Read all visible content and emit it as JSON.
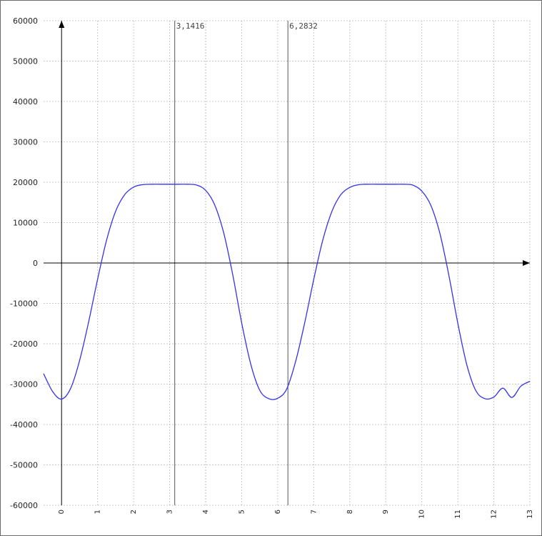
{
  "chart_data": {
    "type": "line",
    "title": "",
    "xlabel": "",
    "ylabel": "",
    "xlim": [
      -0.5,
      13
    ],
    "ylim": [
      -60000,
      60000
    ],
    "x_ticks": [
      0,
      1,
      2,
      3,
      4,
      5,
      6,
      7,
      8,
      9,
      10,
      11,
      12,
      13
    ],
    "y_ticks": [
      60000,
      50000,
      40000,
      30000,
      20000,
      10000,
      0,
      -10000,
      -20000,
      -30000,
      -40000,
      -50000,
      -60000
    ],
    "grid": true,
    "legend": "none",
    "colors": {
      "series": "#3333ee",
      "axes": "#000000",
      "grid": "#c8c8c8",
      "markers": "#555555"
    },
    "markers": [
      {
        "x": 3.1416,
        "label": "3,1416"
      },
      {
        "x": 6.2832,
        "label": "6,2832"
      }
    ],
    "series": [
      {
        "x": [
          -0.5,
          -0.25,
          0,
          0.25,
          0.5,
          0.75,
          1,
          1.25,
          1.5,
          1.75,
          2,
          2.25,
          2.5,
          2.75,
          3,
          3.25,
          3.5,
          3.75,
          4,
          4.25,
          4.5,
          4.75,
          5,
          5.25,
          5.5,
          5.75,
          6,
          6.25,
          6.5,
          6.75,
          7,
          7.25,
          7.5,
          7.75,
          8,
          8.25,
          8.5,
          8.75,
          9,
          9.25,
          9.5,
          9.75,
          10,
          10.25,
          10.5,
          10.75,
          11,
          11.25,
          11.5,
          11.75,
          12,
          12.25,
          12.5,
          12.75,
          13
        ],
        "values": [
          -27400,
          -31800,
          -33700,
          -31100,
          -24200,
          -14600,
          -4000,
          5700,
          12800,
          16900,
          18800,
          19400,
          19500,
          19500,
          19500,
          19500,
          19500,
          19300,
          18000,
          14400,
          7500,
          -2800,
          -14800,
          -25000,
          -31500,
          -33600,
          -33500,
          -31200,
          -24300,
          -14800,
          -4100,
          5600,
          12700,
          16900,
          18700,
          19400,
          19500,
          19500,
          19500,
          19500,
          19500,
          19300,
          17800,
          14300,
          7400,
          -3000,
          -14900,
          -25200,
          -31600,
          -33600,
          -33200,
          -31000,
          -33300,
          -30500,
          -29300
        ]
      }
    ]
  }
}
